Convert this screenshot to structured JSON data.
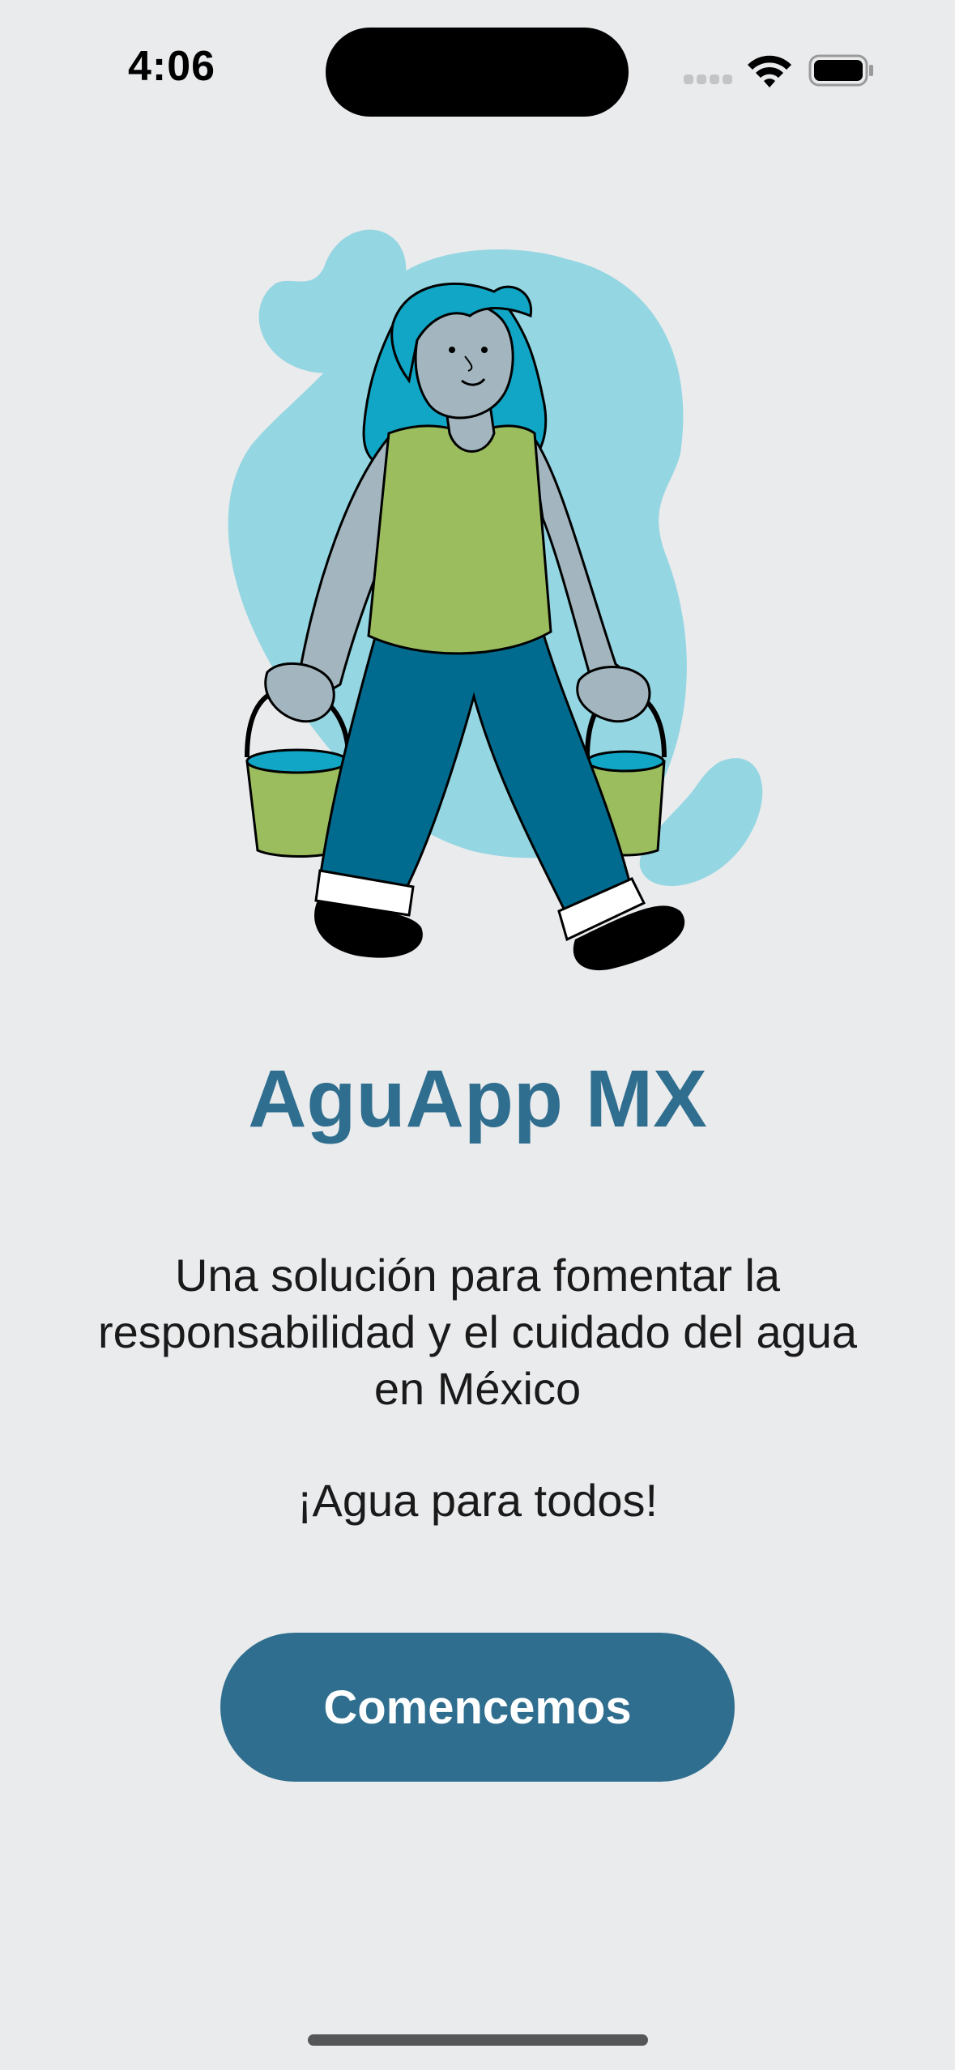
{
  "status_bar": {
    "time": "4:06",
    "signal_icon": "cellular-signal-icon",
    "wifi_icon": "wifi-icon",
    "battery_icon": "battery-full-icon"
  },
  "illustration": {
    "icon": "woman-carrying-water-buckets-illustration"
  },
  "main": {
    "title": "AguApp MX",
    "description": "Una solución para fomentar la responsabilidad y el cuidado del agua en México",
    "tagline": "¡Agua para todos!",
    "start_button_label": "Comencemos"
  },
  "colors": {
    "background": "#EAEBED",
    "primary": "#2F6E8E",
    "blob": "#94D6E2",
    "hair": "#11A6C6",
    "shirt": "#9BBD5E",
    "skin": "#A3B6BF",
    "pants": "#006B8E"
  }
}
